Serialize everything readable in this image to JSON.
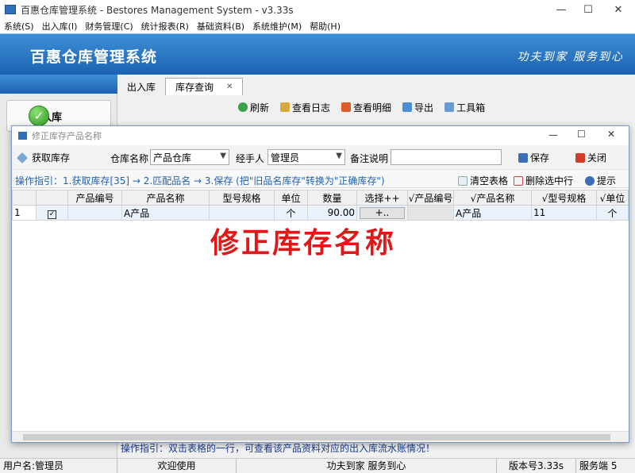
{
  "window": {
    "title": "百惠仓库管理系统 - Bestores Management System - v3.33s"
  },
  "menu": [
    "系统(S)",
    "出入库(I)",
    "财务管理(C)",
    "统计报表(R)",
    "基础资料(B)",
    "系统维护(M)",
    "帮助(H)"
  ],
  "banner": {
    "brand": "百惠仓库管理系统",
    "slogan": "功夫到家 服务到心"
  },
  "left_nav": {
    "button_label": "出入库"
  },
  "tabs": [
    {
      "label": "出入库"
    },
    {
      "label": "库存查询"
    }
  ],
  "main_toolbar": [
    {
      "label": "刷新",
      "icon": "refresh-icon"
    },
    {
      "label": "查看日志",
      "icon": "log-icon"
    },
    {
      "label": "查看明细",
      "icon": "home-icon"
    },
    {
      "label": "导出",
      "icon": "export-icon"
    },
    {
      "label": "工具箱",
      "icon": "toolbox-icon"
    }
  ],
  "dialog": {
    "title": "修正库存产品名称",
    "fetch_label": "获取库存",
    "warehouse_label": "仓库名称",
    "warehouse_value": "产品仓库",
    "handler_label": "经手人",
    "handler_value": "管理员",
    "note_label": "备注说明",
    "note_value": "",
    "save_label": "保存",
    "close_label": "关闭",
    "guide": "操作指引：1.获取库存[35] → 2.匹配品名 → 3.保存 (把\"旧品名库存\"转换为\"正确库存\")",
    "clear_label": "清空表格",
    "delete_label": "删除选中行",
    "hint_label": "提示",
    "columns": [
      "",
      "",
      "产品编号",
      "产品名称",
      "型号规格",
      "单位",
      "数量",
      "选择++",
      "√产品编号",
      "√产品名称",
      "√型号规格",
      "√单位"
    ],
    "rows": [
      {
        "idx": "1",
        "code": "",
        "name": "A产品",
        "spec": "",
        "unit": "个",
        "qty": "90.00",
        "pick": "+..",
        "new_code": "",
        "new_name": "A产品",
        "new_spec": "11",
        "new_unit": "个"
      }
    ],
    "overlay": "修正库存名称"
  },
  "bottom_guide": "操作指引：双击表格的一行，可查看该产品资料对应的出入库流水账情况！",
  "status": {
    "user": "用户名:管理员",
    "welcome": "欢迎使用",
    "motto": "功夫到家 服务到心",
    "version": "版本号3.33s",
    "service": "服务端 5"
  },
  "colors": {
    "banner_top": "#3f8fd6",
    "banner_bottom": "#1b62b2",
    "overlay_red": "#e01818",
    "guide_blue": "#1e62b0"
  }
}
